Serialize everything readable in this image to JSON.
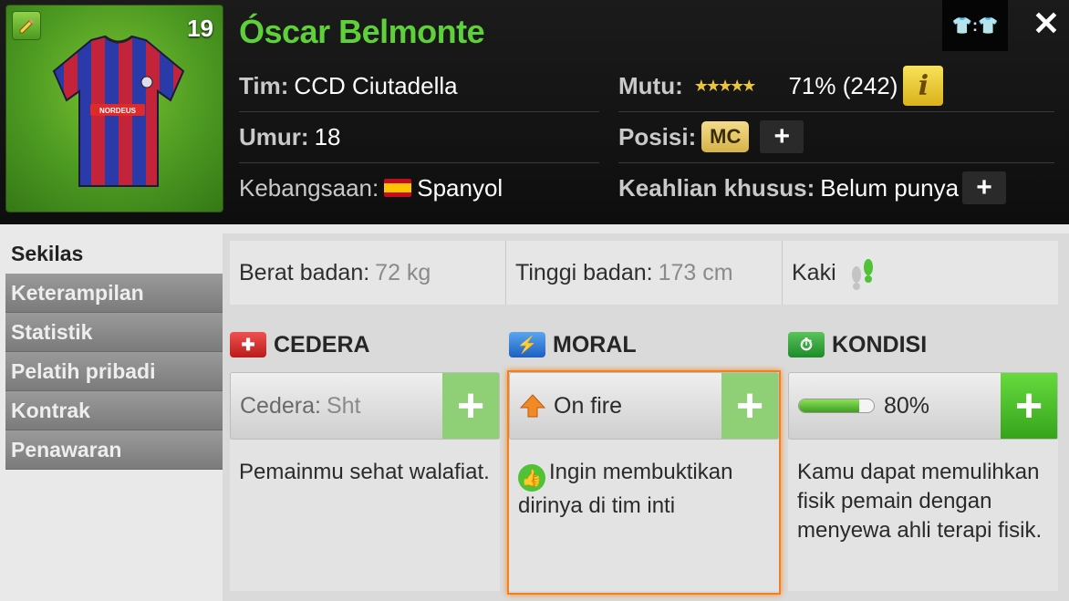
{
  "header": {
    "player_name": "Óscar Belmonte",
    "shirt_number": "19",
    "kit_toggle": "👕:👕",
    "close": "✕",
    "team_label": "Tim:",
    "team_value": "CCD Ciutadella",
    "age_label": "Umur:",
    "age_value": "18",
    "nationality_label": "Kebangsaan:",
    "nationality_value": "Spanyol",
    "quality_label": "Mutu:",
    "quality_stars": "★★★★★",
    "quality_value": "71% (242)",
    "info_button": "i",
    "position_label": "Posisi:",
    "position_value": "MC",
    "add_position": "+",
    "special_label": "Keahlian khusus:",
    "special_value": "Belum punya",
    "add_special": "+"
  },
  "sidebar": {
    "items": [
      {
        "label": "Sekilas"
      },
      {
        "label": "Keterampilan"
      },
      {
        "label": "Statistik"
      },
      {
        "label": "Pelatih pribadi"
      },
      {
        "label": "Kontrak"
      },
      {
        "label": "Penawaran"
      }
    ]
  },
  "stats": {
    "weight_label": "Berat badan:",
    "weight_value": "72 kg",
    "height_label": "Tinggi badan:",
    "height_value": "173 cm",
    "foot_label": "Kaki"
  },
  "injury": {
    "title": "CEDERA",
    "field_label": "Cedera:",
    "field_value": "Sht",
    "add": "+",
    "description": "Pemainmu sehat walafiat."
  },
  "morale": {
    "title": "MORAL",
    "value": "On fire",
    "add": "+",
    "description": "Ingin membuktikan dirinya di tim inti"
  },
  "condition": {
    "title": "KONDISI",
    "value": "80%",
    "level": 0.8,
    "add": "+",
    "description": "Kamu dapat memulihkan fisik pemain dengan menyewa ahli terapi fisik."
  },
  "colors": {
    "name_green": "#5ed13a",
    "plus_green": "#4fc236",
    "morale_frame": "#f08020"
  }
}
